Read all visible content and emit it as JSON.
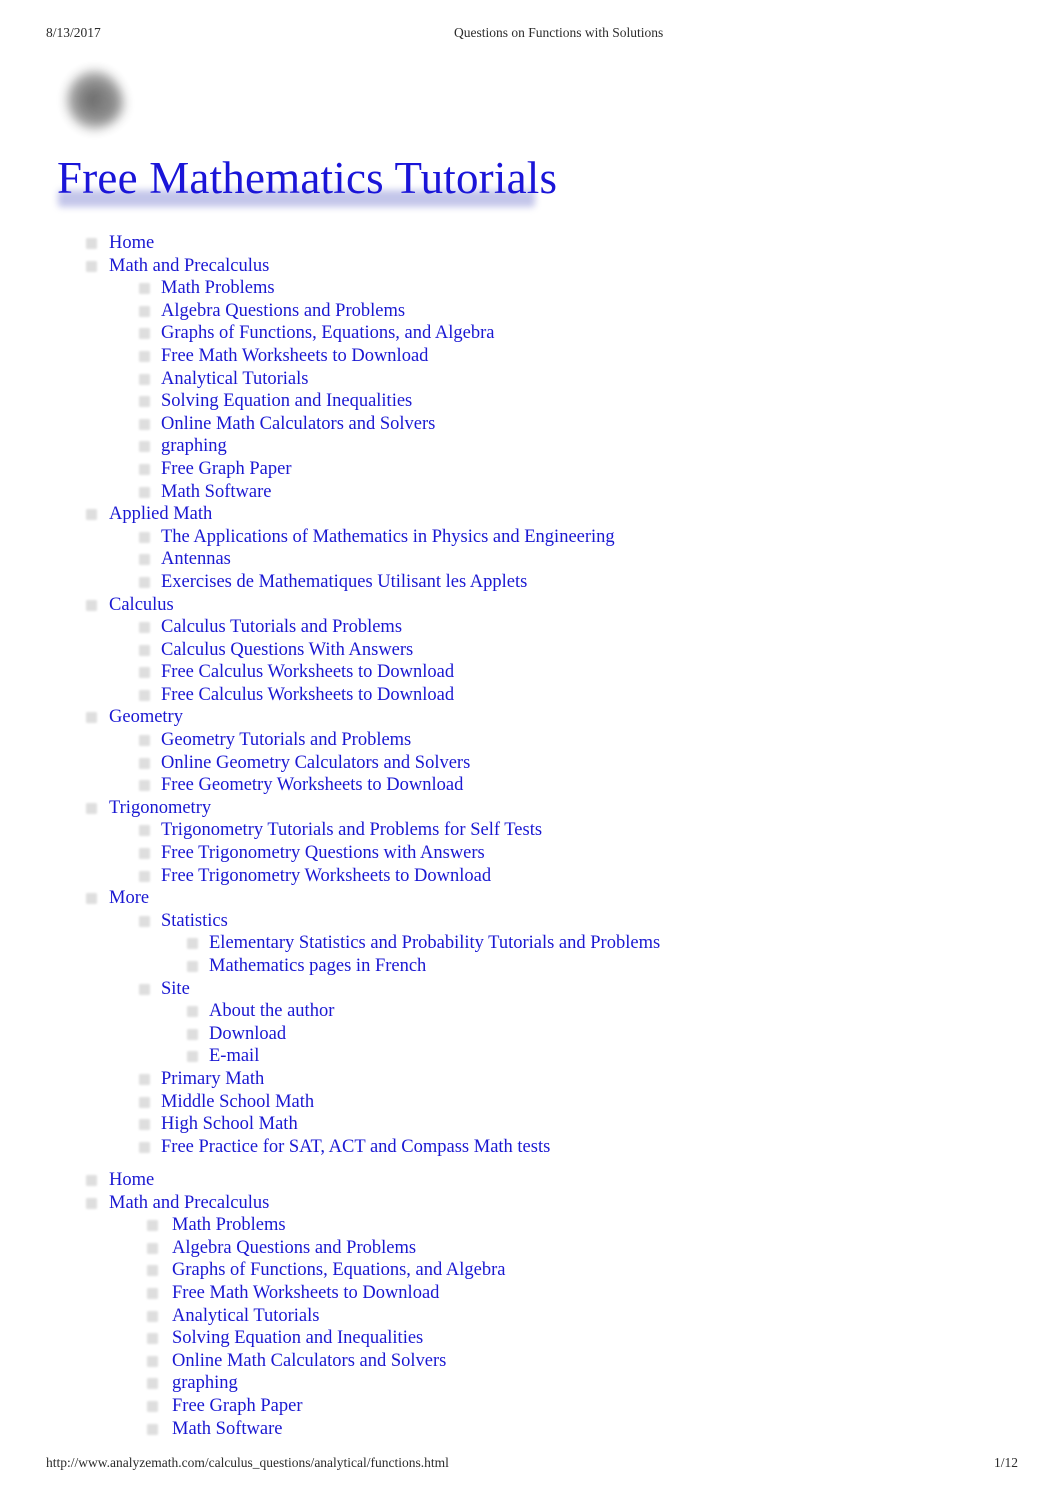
{
  "print_header": {
    "date": "8/13/2017",
    "document_title": "Questions on Functions with Solutions"
  },
  "branding": {
    "logo_alt": "Free Mathematics Tutorials logo",
    "site_title": "Free Mathematics Tutorials",
    "title_color": "#1a15d8",
    "title_underline_color": "#b9bce6"
  },
  "nav_primary": [
    {
      "level": 1,
      "label": "Home"
    },
    {
      "level": 1,
      "label": "Math and Precalculus"
    },
    {
      "level": 2,
      "label": "Math Problems"
    },
    {
      "level": 2,
      "label": "Algebra Questions and Problems"
    },
    {
      "level": 2,
      "label": "Graphs of Functions, Equations, and Algebra"
    },
    {
      "level": 2,
      "label": "Free Math Worksheets to Download"
    },
    {
      "level": 2,
      "label": "Analytical Tutorials"
    },
    {
      "level": 2,
      "label": "Solving Equation and Inequalities"
    },
    {
      "level": 2,
      "label": "Online Math Calculators and Solvers"
    },
    {
      "level": 2,
      "label": "graphing"
    },
    {
      "level": 2,
      "label": "Free Graph Paper"
    },
    {
      "level": 2,
      "label": "Math Software"
    },
    {
      "level": 1,
      "label": "Applied Math"
    },
    {
      "level": 2,
      "label": "The Applications of Mathematics in Physics and Engineering"
    },
    {
      "level": 2,
      "label": "Antennas"
    },
    {
      "level": 2,
      "label": "Exercises de Mathematiques Utilisant les Applets"
    },
    {
      "level": 1,
      "label": "Calculus"
    },
    {
      "level": 2,
      "label": "Calculus Tutorials and Problems"
    },
    {
      "level": 2,
      "label": "Calculus Questions With Answers"
    },
    {
      "level": 2,
      "label": "Free Calculus Worksheets to Download"
    },
    {
      "level": 2,
      "label": "Free Calculus Worksheets to Download"
    },
    {
      "level": 1,
      "label": "Geometry"
    },
    {
      "level": 2,
      "label": "Geometry Tutorials and Problems"
    },
    {
      "level": 2,
      "label": "Online Geometry Calculators and Solvers"
    },
    {
      "level": 2,
      "label": "Free Geometry Worksheets to Download"
    },
    {
      "level": 1,
      "label": "Trigonometry"
    },
    {
      "level": 2,
      "label": "Trigonometry Tutorials and Problems for Self Tests"
    },
    {
      "level": 2,
      "label": "Free Trigonometry Questions with Answers"
    },
    {
      "level": 2,
      "label": "Free Trigonometry Worksheets to Download"
    },
    {
      "level": 1,
      "label": "More"
    },
    {
      "level": 2,
      "label": "Statistics"
    },
    {
      "level": 3,
      "label": "Elementary Statistics and Probability Tutorials and Problems"
    },
    {
      "level": 3,
      "label": "Mathematics pages in French"
    },
    {
      "level": 2,
      "label": "Site"
    },
    {
      "level": 3,
      "label": "About the author"
    },
    {
      "level": 3,
      "label": "Download"
    },
    {
      "level": 3,
      "label": "E-mail"
    },
    {
      "level": 2,
      "label": "Primary Math"
    },
    {
      "level": 2,
      "label": "Middle School Math"
    },
    {
      "level": 2,
      "label": "High School Math"
    },
    {
      "level": 2,
      "label": "Free Practice for SAT, ACT and Compass Math tests"
    }
  ],
  "nav_secondary": [
    {
      "level": 1,
      "label": "Home"
    },
    {
      "level": 1,
      "label": "Math and Precalculus"
    },
    {
      "level": 2,
      "label": "Math Problems"
    },
    {
      "level": 2,
      "label": "Algebra Questions and Problems"
    },
    {
      "level": 2,
      "label": "Graphs of Functions, Equations, and Algebra"
    },
    {
      "level": 2,
      "label": "Free Math Worksheets to Download"
    },
    {
      "level": 2,
      "label": "Analytical Tutorials"
    },
    {
      "level": 2,
      "label": "Solving Equation and Inequalities"
    },
    {
      "level": 2,
      "label": "Online Math Calculators and Solvers"
    },
    {
      "level": 2,
      "label": "graphing"
    },
    {
      "level": 2,
      "label": "Free Graph Paper"
    },
    {
      "level": 2,
      "label": "Math Software"
    }
  ],
  "print_footer": {
    "url": "http://www.analyzemath.com/calculus_questions/analytical/functions.html",
    "page_number": "1/12"
  }
}
